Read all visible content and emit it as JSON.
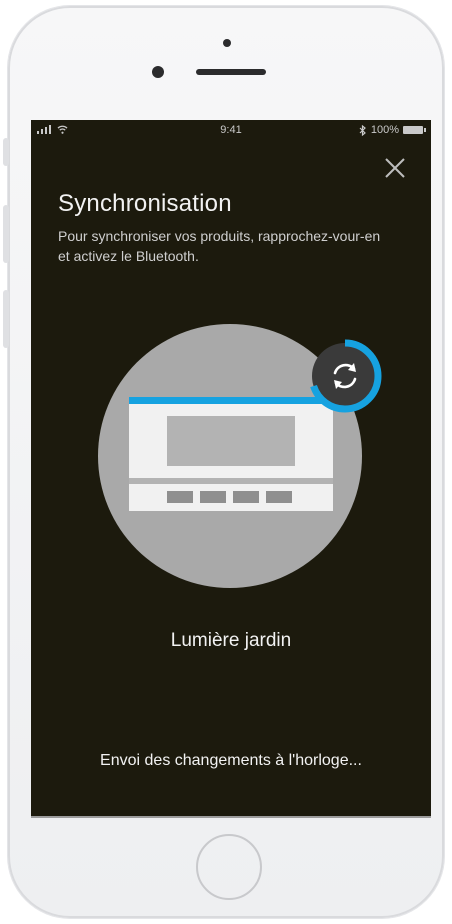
{
  "status_bar": {
    "time": "9:41",
    "battery": "100%",
    "icons": [
      "signal-icon",
      "wifi-icon",
      "bluetooth-icon",
      "battery-icon"
    ]
  },
  "sync": {
    "title": "Synchronisation",
    "subtitle": "Pour synchroniser vos produits, rapprochez-vour-en et activez le Bluetooth.",
    "device_name": "Lumière jardin",
    "status": "Envoi des changements à l'horloge...",
    "close_icon": "close-icon",
    "sync_icon": "sync-icon"
  },
  "colors": {
    "screen_background": "#1c1a0d",
    "accent": "#16a2e0",
    "circle": "#a9a9a9"
  }
}
